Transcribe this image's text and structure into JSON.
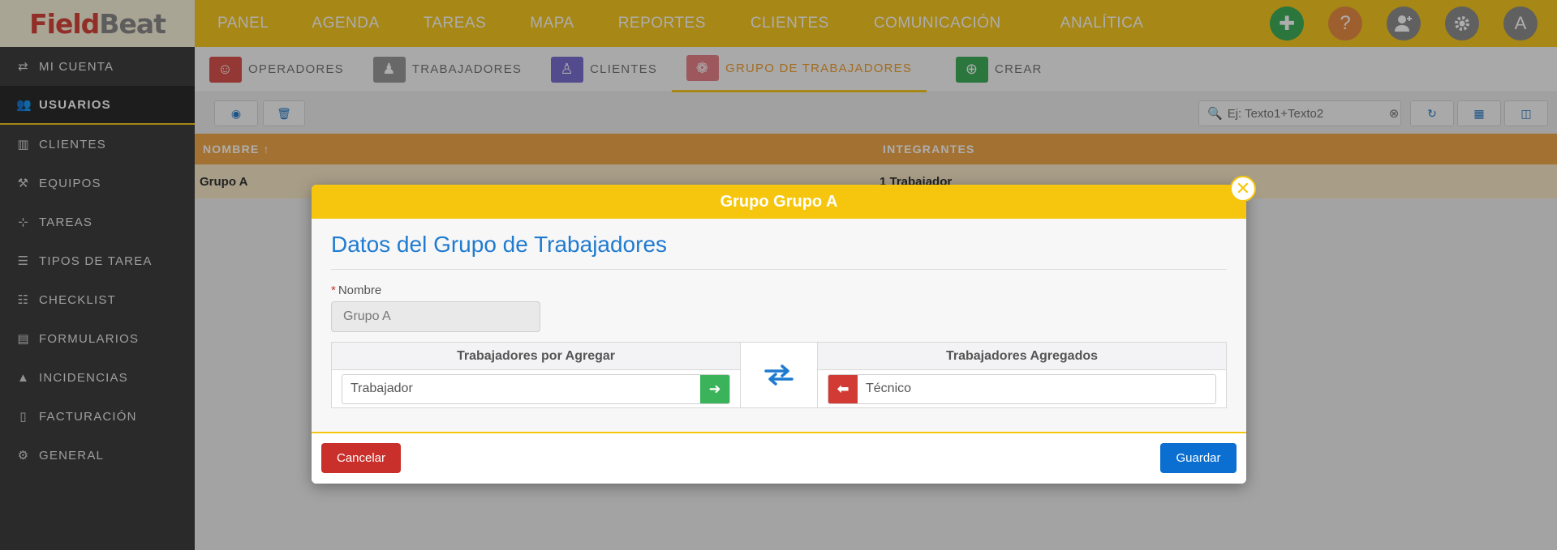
{
  "app": {
    "logo_part1": "Field",
    "logo_part2": "Beat",
    "top_nav": [
      "PANEL",
      "AGENDA",
      "TAREAS",
      "MAPA",
      "REPORTES",
      "CLIENTES",
      "COMUNICACIÓN",
      "ANALÍTICA"
    ],
    "avatar_letter": "A",
    "colors": {
      "brand": "#f6c81f",
      "sidebar": "#3e3e3e",
      "accent_blue": "#1f7bd0"
    }
  },
  "sidebar": {
    "items": [
      {
        "label": "MI CUENTA",
        "icon": "transfer-icon"
      },
      {
        "label": "USUARIOS",
        "icon": "users-icon",
        "active": true
      },
      {
        "label": "CLIENTES",
        "icon": "building-icon"
      },
      {
        "label": "EQUIPOS",
        "icon": "equipment-icon"
      },
      {
        "label": "TAREAS",
        "icon": "tasks-icon"
      },
      {
        "label": "TIPOS DE TAREA",
        "icon": "task-types-icon"
      },
      {
        "label": "CHECKLIST",
        "icon": "checklist-icon"
      },
      {
        "label": "FORMULARIOS",
        "icon": "clipboard-icon"
      },
      {
        "label": "INCIDENCIAS",
        "icon": "warning-icon"
      },
      {
        "label": "FACTURACIÓN",
        "icon": "file-icon"
      },
      {
        "label": "GENERAL",
        "icon": "gear-icon"
      }
    ]
  },
  "tabs": [
    {
      "label": "OPERADORES",
      "icon": "operator-icon",
      "color": "#d9534f"
    },
    {
      "label": "TRABAJADORES",
      "icon": "worker-icon",
      "color": "#9a9a9a"
    },
    {
      "label": "CLIENTES",
      "icon": "client-icon",
      "color": "#7a6fd0"
    },
    {
      "label": "GRUPO DE TRABAJADORES",
      "icon": "group-icon",
      "color": "#e8828a",
      "active": true
    },
    {
      "label": "CREAR",
      "icon": "plus-circle-icon",
      "color": "#3fae5a"
    }
  ],
  "toolbar": {
    "search_placeholder": "Ej: Texto1+Texto2"
  },
  "grid": {
    "columns": [
      "NOMBRE ↑",
      "INTEGRANTES"
    ],
    "rows": [
      {
        "nombre": "Grupo A",
        "integrantes": "1 Trabajador"
      }
    ]
  },
  "modal": {
    "header": "Grupo Grupo A",
    "title": "Datos del Grupo de Trabajadores",
    "name_label": "Nombre",
    "name_value": "Grupo A",
    "available_header": "Trabajadores por Agregar",
    "added_header": "Trabajadores Agregados",
    "available_item": "Trabajador",
    "added_item": "Técnico",
    "cancel_label": "Cancelar",
    "save_label": "Guardar"
  }
}
